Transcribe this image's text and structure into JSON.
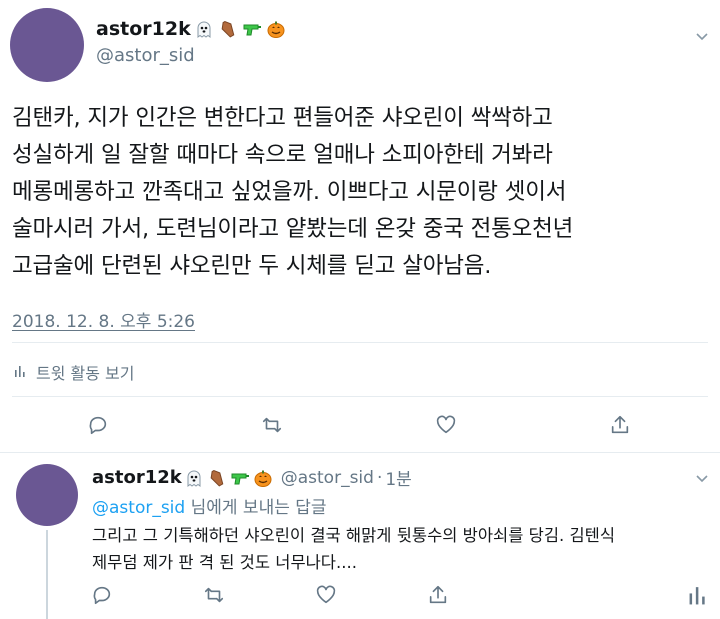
{
  "main": {
    "author_name": "astor12k",
    "author_emojis": [
      "ghost-emoji",
      "coffin-emoji",
      "water-pistol-emoji",
      "jack-o-lantern-emoji"
    ],
    "handle": "@astor_sid",
    "text_lines": [
      "김탠카, 지가 인간은 변한다고 편들어준 샤오린이 싹싹하고",
      "성실하게 일 잘할 때마다 속으로 얼매나 소피아한테 거봐라",
      "메롱메롱하고 깐족대고 싶었을까. 이쁘다고 시문이랑 셋이서",
      "술마시러 가서, 도련님이라고 얕봤는데 온갖 중국 전통오천년",
      "고급술에 단련된 샤오린만 두 시체를 딛고 살아남음."
    ],
    "timestamp": "2018. 12. 8. 오후 5:26",
    "activity_label": "트윗 활동 보기"
  },
  "reply": {
    "author_name": "astor12k",
    "handle": "@astor_sid",
    "separator": "·",
    "time_ago": "1분",
    "reply_to_handle": "@astor_sid",
    "reply_to_suffix": " 님에게 보내는 답글",
    "text_lines": [
      "그리고 그 기특해하던 샤오린이 결국 해맑게 뒷통수의 방아쇠를 당김. 김텐식",
      "제무덤 제가 판 격 된 것도 너무나다...."
    ]
  },
  "colors": {
    "avatar": "#6a5793",
    "text": "#14171a",
    "muted": "#657786",
    "link": "#1da1f2",
    "divider": "#e6ecf0"
  }
}
